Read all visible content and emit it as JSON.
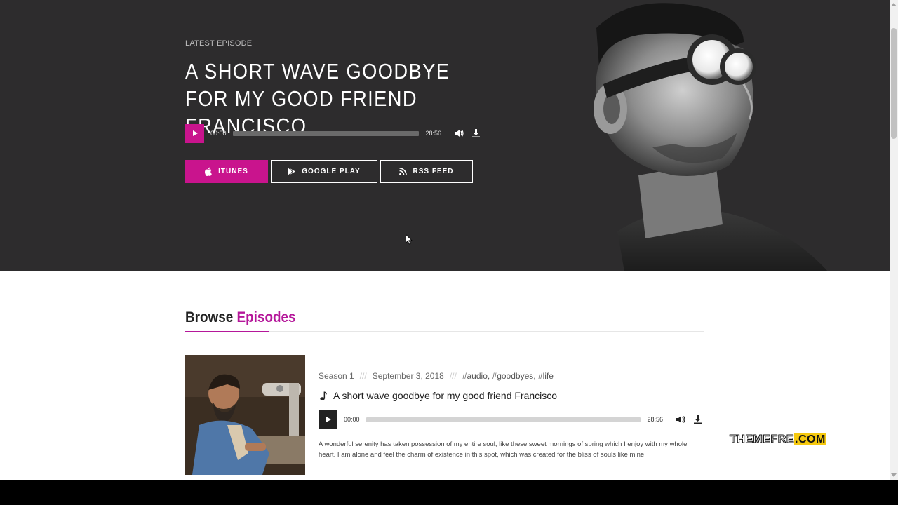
{
  "hero": {
    "label": "LATEST EPISODE",
    "title": "A SHORT WAVE GOODBYE FOR MY GOOD FRIEND FRANCISCO",
    "player": {
      "current_time": "00:00",
      "duration": "28:56"
    },
    "buttons": {
      "itunes": "ITUNES",
      "google_play": "GOOGLE PLAY",
      "rss": "RSS FEED"
    }
  },
  "browse": {
    "title_plain": "Browse",
    "title_accent": "Episodes"
  },
  "episode": {
    "season": "Season 1",
    "separator": "///",
    "date": "September 3, 2018",
    "tags": "#audio, #goodbyes, #life",
    "title": "A short wave goodbye for my good friend Francisco",
    "player": {
      "current_time": "00:00",
      "duration": "28:56"
    },
    "description": "A wonderful serenity has taken possession of my entire soul, like these sweet mornings of spring which I enjoy with my whole heart. I am alone and feel the charm of existence in this spot, which was created for the bliss of souls like mine."
  },
  "watermark": {
    "main": "THEMEFRE",
    "suffix": ".COM"
  },
  "colors": {
    "accent": "#c9148d",
    "hero_bg": "#2d2c2d",
    "browse_accent": "#b5179a"
  },
  "icons": [
    "play-icon",
    "volume-icon",
    "download-icon",
    "apple-icon",
    "google-play-icon",
    "rss-icon",
    "music-note-icon",
    "cursor-icon"
  ]
}
